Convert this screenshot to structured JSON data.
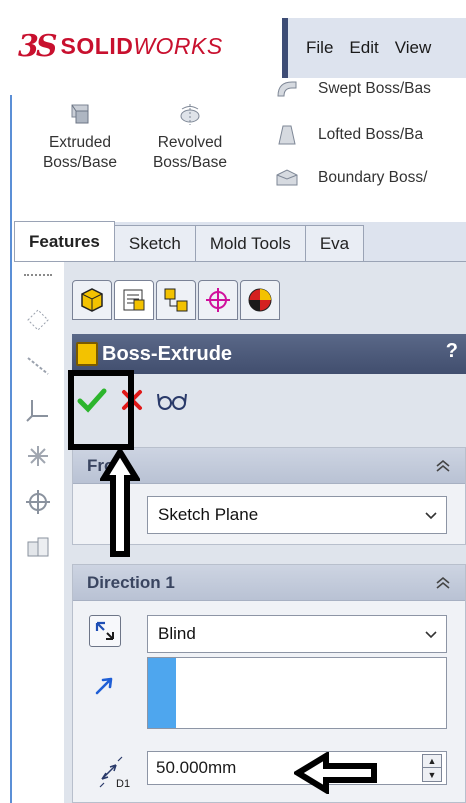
{
  "app": {
    "logo_mark": "3S",
    "brand_bold": "SOLID",
    "brand_italic": "WORKS",
    "menu": [
      "File",
      "Edit",
      "View"
    ],
    "brand_color": "#c8102e"
  },
  "ribbon": {
    "extruded": {
      "label_line1": "Extruded",
      "label_line2": "Boss/Base",
      "icon": "extruded-boss-icon"
    },
    "revolved": {
      "label_line1": "Revolved",
      "label_line2": "Boss/Base",
      "icon": "revolved-boss-icon"
    },
    "swept": {
      "label": "Swept Boss/Bas",
      "icon": "swept-boss-icon"
    },
    "lofted": {
      "label": "Lofted Boss/Ba",
      "icon": "lofted-boss-icon"
    },
    "boundary": {
      "label": "Boundary Boss/",
      "icon": "boundary-boss-icon"
    }
  },
  "tabs": [
    {
      "label": "Features",
      "active": true
    },
    {
      "label": "Sketch",
      "active": false
    },
    {
      "label": "Mold Tools",
      "active": false
    },
    {
      "label": "Eva",
      "active": false
    }
  ],
  "property_manager": {
    "title": "Boss-Extrude",
    "help": "?",
    "from_group": {
      "title": "From",
      "start_condition": "Sketch Plane"
    },
    "direction1_group": {
      "title": "Direction 1",
      "end_condition": "Blind",
      "depth": "50.000mm",
      "depth_icon_label": "D1"
    }
  }
}
